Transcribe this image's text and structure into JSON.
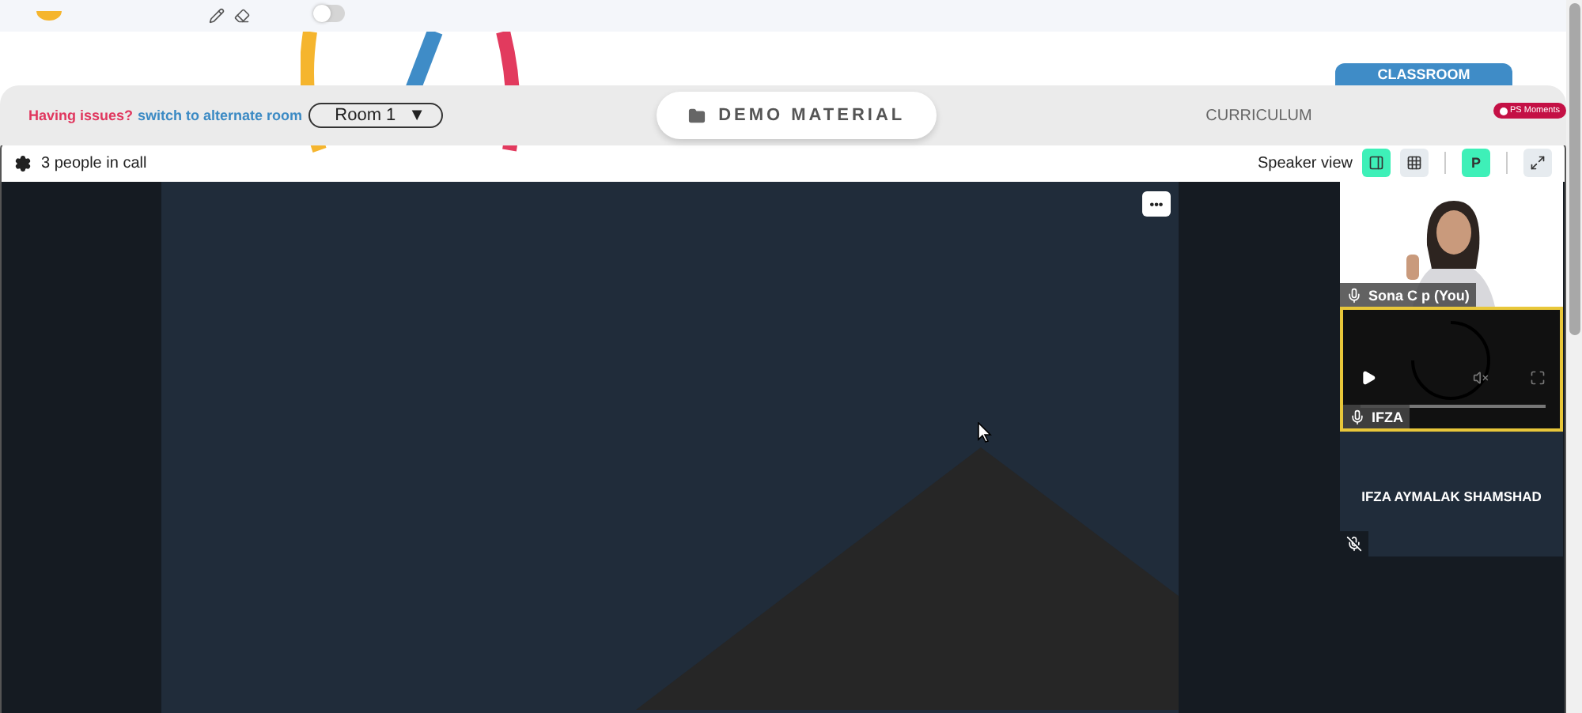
{
  "toolbar": {
    "toggle": {
      "on": false
    }
  },
  "issues": {
    "prompt": "Having issues?",
    "link": "switch to alternate room"
  },
  "room_select": {
    "value": "Room 1",
    "caret": "▼"
  },
  "tabs": [
    {
      "label": "DEMO MATERIAL",
      "selected": true
    },
    {
      "label": "CURRICULUM",
      "selected": false
    }
  ],
  "classroom_tab": {
    "label": "CLASSROOM"
  },
  "moments_badge": {
    "label": "PS Moments"
  },
  "call": {
    "people": "3 people in call",
    "view_label": "Speaker view",
    "view_modes": [
      {
        "kind": "speaker",
        "selected": true
      },
      {
        "kind": "grid",
        "selected": false
      }
    ],
    "presenter": {
      "label": "P",
      "on": true
    },
    "menu": "•••",
    "tiles": [
      {
        "kind": "camera",
        "name": "Sona C p (You)",
        "muted": false,
        "highlighted": false
      },
      {
        "kind": "player",
        "name": "IFZA",
        "muted": false,
        "highlighted": true
      },
      {
        "kind": "avatar",
        "name": "IFZA AYMALAK SHAMSHAD",
        "muted": true,
        "highlighted": false
      }
    ]
  }
}
